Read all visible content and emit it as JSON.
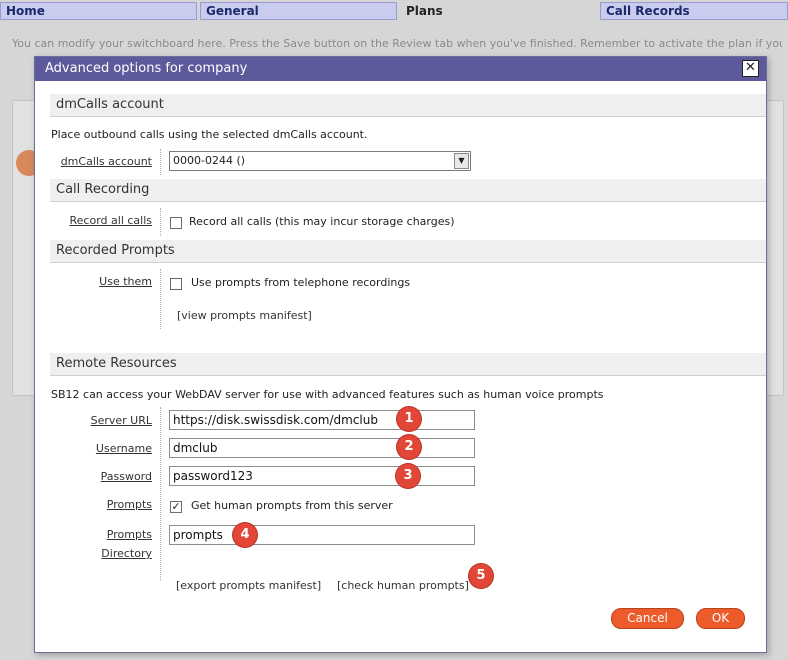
{
  "nav": {
    "tabs": [
      {
        "label": "Home"
      },
      {
        "label": "General"
      },
      {
        "label": "Plans"
      },
      {
        "label": "Call Records"
      }
    ]
  },
  "notice": "You can modify your switchboard here. Press the Save button on the Review tab when you've finished. Remember to activate the plan if you",
  "dialog": {
    "title": "Advanced options for company",
    "close_glyph": "✕",
    "dmcalls": {
      "heading": "dmCalls account",
      "description": "Place outbound calls using the selected dmCalls account.",
      "label": "dmCalls account",
      "selected": "0000-0244 ()"
    },
    "recording": {
      "heading": "Call Recording",
      "label": "Record all calls",
      "checkbox_text": "Record all calls (this may incur storage charges)",
      "checked": false
    },
    "prompts": {
      "heading": "Recorded Prompts",
      "label": "Use them",
      "checkbox_text": "Use prompts from telephone recordings",
      "checked": false,
      "view_link": "[view prompts manifest]"
    },
    "remote": {
      "heading": "Remote Resources",
      "description": "SB12 can access your WebDAV server for use with advanced features such as human voice prompts",
      "server_label": "Server URL",
      "server_value": "https://disk.swissdisk.com/dmclub",
      "username_label": "Username",
      "username_value": "dmclub",
      "password_label": "Password",
      "password_value": "password123",
      "prompts_label": "Prompts",
      "prompts_checkbox_text": "Get human prompts from this server",
      "prompts_checked": true,
      "dir_label_1": "Prompts",
      "dir_label_2": "Directory",
      "dir_value": "prompts",
      "export_link": "[export prompts manifest]",
      "check_link": "[check human prompts]"
    },
    "badges": [
      "1",
      "2",
      "3",
      "4",
      "5"
    ],
    "cancel_label": "Cancel",
    "ok_label": "OK"
  },
  "colors": {
    "titlebar": "#5d5a9c",
    "nav_tab": "#c9cbef",
    "badge": "#e24637",
    "button": "#ee5b2b"
  }
}
